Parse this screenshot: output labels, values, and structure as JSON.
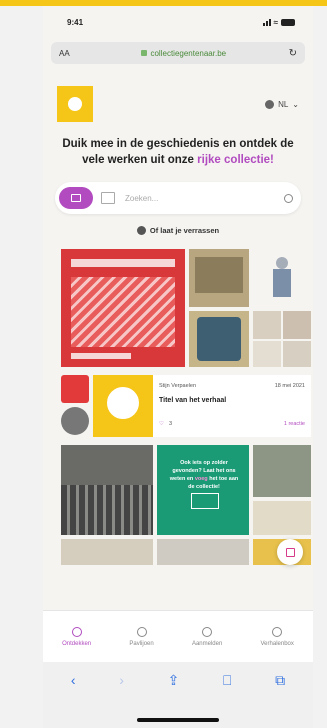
{
  "status": {
    "time": "9:41"
  },
  "browser": {
    "aa": "AA",
    "url": "collectiegentenaar.be",
    "reload": "↻"
  },
  "site": {
    "lang": "NL",
    "headline_part1": "Duik mee in de geschiedenis en ontdek de vele werken uit onze",
    "headline_accent": "rijke collectie!",
    "search_placeholder": "Zoeken...",
    "surprise": "Of laat je verrassen"
  },
  "story_card": {
    "author": "Stijn Verpaelen",
    "date": "18 mei 2021",
    "title": "Titel van het verhaal",
    "likes": "3",
    "more": "1 reactie"
  },
  "green_card": {
    "text_before": "Ook iets op zolder gevonden? Laat het ons weten en",
    "text_accent": "voeg",
    "text_after": "het toe aan de collectie!"
  },
  "tabs": [
    {
      "label": "Ontdekken",
      "icon": "search-icon",
      "active": true
    },
    {
      "label": "Pavlijoen",
      "icon": "globe-icon",
      "active": false
    },
    {
      "label": "Aanmelden",
      "icon": "user-icon",
      "active": false
    },
    {
      "label": "Verhalenbox",
      "icon": "box-icon",
      "active": false
    }
  ],
  "colors": {
    "accent": "#b14bbf",
    "brand_yellow": "#f5c518",
    "green": "#1a9b76"
  }
}
